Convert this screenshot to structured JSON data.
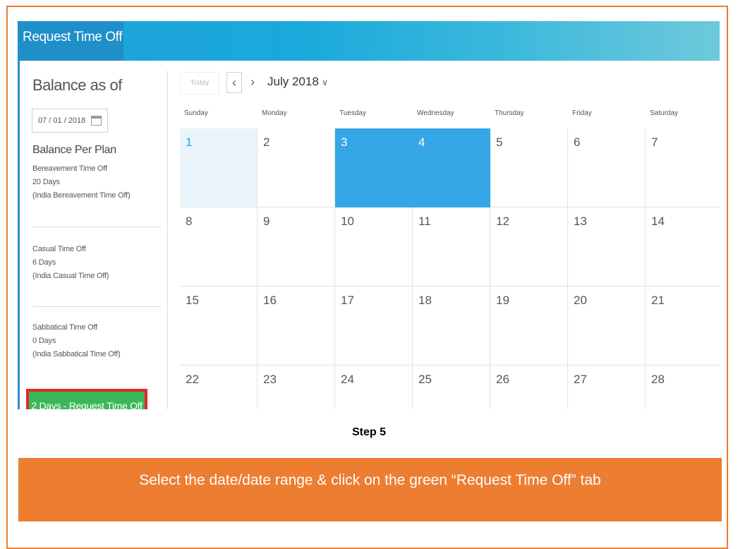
{
  "app": {
    "title": "Request Time Off"
  },
  "sidebar": {
    "balance_title": "Balance as of",
    "date_value": "07 / 01 / 2018",
    "plan_title": "Balance Per Plan",
    "plans": [
      {
        "name": "Bereavement Time Off",
        "days": "20 Days",
        "detail": "(India Bereavement Time Off)"
      },
      {
        "name": "Casual Time Off",
        "days": "6 Days",
        "detail": "(India Casual Time Off)"
      },
      {
        "name": "Sabbatical Time Off",
        "days": "0 Days",
        "detail": "(India Sabbatical Time Off)"
      }
    ],
    "request_button": "2 Days - Request Time Off",
    "request_button_color": "#3bb75a",
    "highlight_color": "#e4262c"
  },
  "calendar": {
    "today_label": "Today",
    "prev_icon": "chevron-left-icon",
    "next_icon": "chevron-right-icon",
    "month_label": "July 2018",
    "days_of_week": [
      "Sunday",
      "Monday",
      "Tuesday",
      "Wednesday",
      "Thursday",
      "Friday",
      "Saturday"
    ],
    "weeks": [
      [
        "1",
        "2",
        "3",
        "4",
        "5",
        "6",
        "7"
      ],
      [
        "8",
        "9",
        "10",
        "11",
        "12",
        "13",
        "14"
      ],
      [
        "15",
        "16",
        "17",
        "18",
        "19",
        "20",
        "21"
      ],
      [
        "22",
        "23",
        "24",
        "25",
        "26",
        "27",
        "28"
      ]
    ],
    "today_date": "1",
    "selected_dates": [
      "3",
      "4"
    ],
    "selected_color": "#35a6e6"
  },
  "caption": {
    "step": "Step 5",
    "instruction": "Select the date/date range & click on the green “Request Time Off” tab",
    "accent_color": "#ed7d31"
  }
}
